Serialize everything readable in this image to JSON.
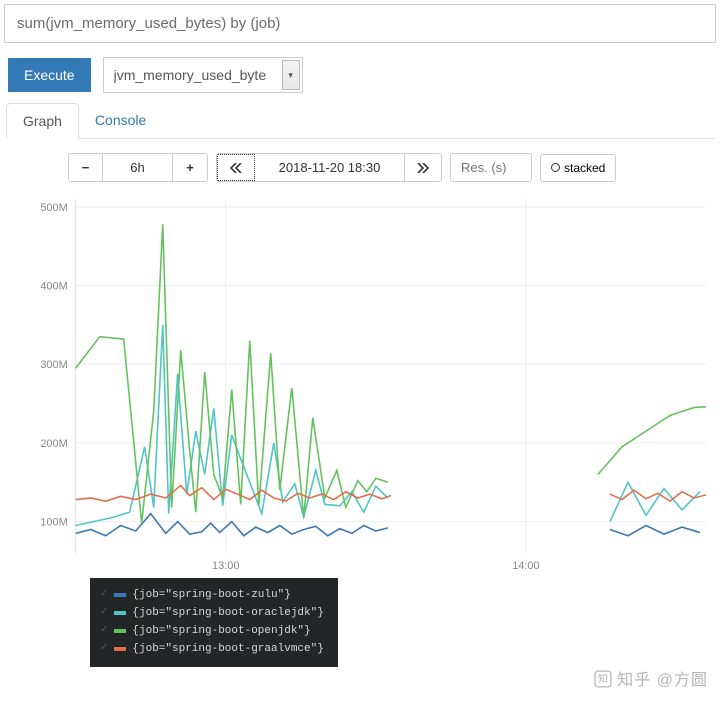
{
  "query": "sum(jvm_memory_used_bytes) by (job)",
  "execute_label": "Execute",
  "metric_select": "jvm_memory_used_byte",
  "tabs": {
    "graph": "Graph",
    "console": "Console"
  },
  "toolbar": {
    "range": "6h",
    "datetime": "2018-11-20 18:30",
    "res_placeholder": "Res. (s)",
    "stacked": "stacked"
  },
  "watermark": "知乎 @方圆",
  "legend": [
    {
      "label": "{job=\"spring-boot-zulu\"}",
      "color": "#3b77b3"
    },
    {
      "label": "{job=\"spring-boot-oraclejdk\"}",
      "color": "#4fc4c9"
    },
    {
      "label": "{job=\"spring-boot-openjdk\"}",
      "color": "#64c25c"
    },
    {
      "label": "{job=\"spring-boot-graalvmce\"}",
      "color": "#e06f4a"
    }
  ],
  "chart_data": {
    "type": "line",
    "title": "",
    "xlabel": "",
    "ylabel": "",
    "ylim": [
      60,
      510
    ],
    "x_ticks": [
      {
        "h": 13,
        "label": "13:00"
      },
      {
        "h": 14,
        "label": "14:00"
      }
    ],
    "y_ticks": [
      100,
      200,
      300,
      400,
      500
    ],
    "x_range_hours": [
      12.5,
      14.6
    ],
    "series": [
      {
        "name": "spring-boot-zulu",
        "color": "#3b77b3",
        "points": [
          [
            12.5,
            85
          ],
          [
            12.55,
            90
          ],
          [
            12.6,
            82
          ],
          [
            12.65,
            95
          ],
          [
            12.7,
            88
          ],
          [
            12.75,
            110
          ],
          [
            12.8,
            85
          ],
          [
            12.84,
            100
          ],
          [
            12.88,
            84
          ],
          [
            12.92,
            87
          ],
          [
            12.95,
            98
          ],
          [
            12.98,
            86
          ],
          [
            13.02,
            100
          ],
          [
            13.06,
            82
          ],
          [
            13.1,
            93
          ],
          [
            13.14,
            86
          ],
          [
            13.18,
            95
          ],
          [
            13.22,
            84
          ],
          [
            13.26,
            90
          ],
          [
            13.3,
            94
          ],
          [
            13.34,
            82
          ],
          [
            13.38,
            91
          ],
          [
            13.42,
            85
          ],
          [
            13.46,
            95
          ],
          [
            13.5,
            88
          ],
          [
            13.54,
            92
          ]
        ],
        "points2": [
          [
            14.28,
            90
          ],
          [
            14.34,
            82
          ],
          [
            14.4,
            95
          ],
          [
            14.46,
            84
          ],
          [
            14.52,
            93
          ],
          [
            14.58,
            86
          ]
        ]
      },
      {
        "name": "spring-boot-oraclejdk",
        "color": "#4fc4c9",
        "points": [
          [
            12.5,
            95
          ],
          [
            12.56,
            100
          ],
          [
            12.62,
            105
          ],
          [
            12.68,
            112
          ],
          [
            12.73,
            195
          ],
          [
            12.76,
            118
          ],
          [
            12.79,
            350
          ],
          [
            12.81,
            110
          ],
          [
            12.84,
            288
          ],
          [
            12.87,
            135
          ],
          [
            12.9,
            215
          ],
          [
            12.93,
            160
          ],
          [
            12.96,
            244
          ],
          [
            12.99,
            120
          ],
          [
            13.02,
            210
          ],
          [
            13.05,
            180
          ],
          [
            13.09,
            140
          ],
          [
            13.12,
            110
          ],
          [
            13.16,
            200
          ],
          [
            13.19,
            125
          ],
          [
            13.23,
            148
          ],
          [
            13.26,
            106
          ],
          [
            13.3,
            165
          ],
          [
            13.33,
            122
          ],
          [
            13.38,
            120
          ],
          [
            13.42,
            138
          ],
          [
            13.46,
            112
          ],
          [
            13.5,
            145
          ],
          [
            13.54,
            130
          ]
        ],
        "points2": [
          [
            14.28,
            100
          ],
          [
            14.34,
            150
          ],
          [
            14.4,
            108
          ],
          [
            14.46,
            142
          ],
          [
            14.52,
            115
          ],
          [
            14.58,
            138
          ]
        ]
      },
      {
        "name": "spring-boot-openjdk",
        "color": "#64c25c",
        "points": [
          [
            12.5,
            295
          ],
          [
            12.58,
            335
          ],
          [
            12.66,
            332
          ],
          [
            12.72,
            98
          ],
          [
            12.76,
            240
          ],
          [
            12.79,
            478
          ],
          [
            12.82,
            118
          ],
          [
            12.85,
            318
          ],
          [
            12.88,
            190
          ],
          [
            12.9,
            112
          ],
          [
            12.93,
            290
          ],
          [
            12.96,
            160
          ],
          [
            12.99,
            130
          ],
          [
            13.02,
            268
          ],
          [
            13.05,
            122
          ],
          [
            13.08,
            330
          ],
          [
            13.11,
            120
          ],
          [
            13.15,
            314
          ],
          [
            13.18,
            140
          ],
          [
            13.22,
            270
          ],
          [
            13.26,
            105
          ],
          [
            13.29,
            232
          ],
          [
            13.33,
            130
          ],
          [
            13.37,
            165
          ],
          [
            13.4,
            118
          ],
          [
            13.44,
            152
          ],
          [
            13.47,
            138
          ],
          [
            13.5,
            155
          ],
          [
            13.54,
            150
          ]
        ],
        "points2": [
          [
            14.24,
            160
          ],
          [
            14.32,
            195
          ],
          [
            14.4,
            215
          ],
          [
            14.48,
            235
          ],
          [
            14.56,
            245
          ],
          [
            14.6,
            246
          ]
        ]
      },
      {
        "name": "spring-boot-graalvmce",
        "color": "#e06f4a",
        "points": [
          [
            12.5,
            128
          ],
          [
            12.55,
            130
          ],
          [
            12.6,
            126
          ],
          [
            12.65,
            132
          ],
          [
            12.7,
            128
          ],
          [
            12.75,
            135
          ],
          [
            12.8,
            130
          ],
          [
            12.85,
            146
          ],
          [
            12.88,
            133
          ],
          [
            12.92,
            143
          ],
          [
            12.96,
            128
          ],
          [
            13.0,
            141
          ],
          [
            13.04,
            135
          ],
          [
            13.08,
            128
          ],
          [
            13.12,
            140
          ],
          [
            13.16,
            130
          ],
          [
            13.2,
            126
          ],
          [
            13.24,
            136
          ],
          [
            13.28,
            130
          ],
          [
            13.32,
            135
          ],
          [
            13.36,
            128
          ],
          [
            13.4,
            138
          ],
          [
            13.44,
            130
          ],
          [
            13.48,
            135
          ],
          [
            13.52,
            129
          ],
          [
            13.55,
            133
          ]
        ],
        "points2": [
          [
            14.28,
            135
          ],
          [
            14.32,
            128
          ],
          [
            14.36,
            140
          ],
          [
            14.4,
            129
          ],
          [
            14.44,
            136
          ],
          [
            14.48,
            126
          ],
          [
            14.52,
            138
          ],
          [
            14.56,
            130
          ],
          [
            14.6,
            134
          ]
        ]
      }
    ]
  }
}
